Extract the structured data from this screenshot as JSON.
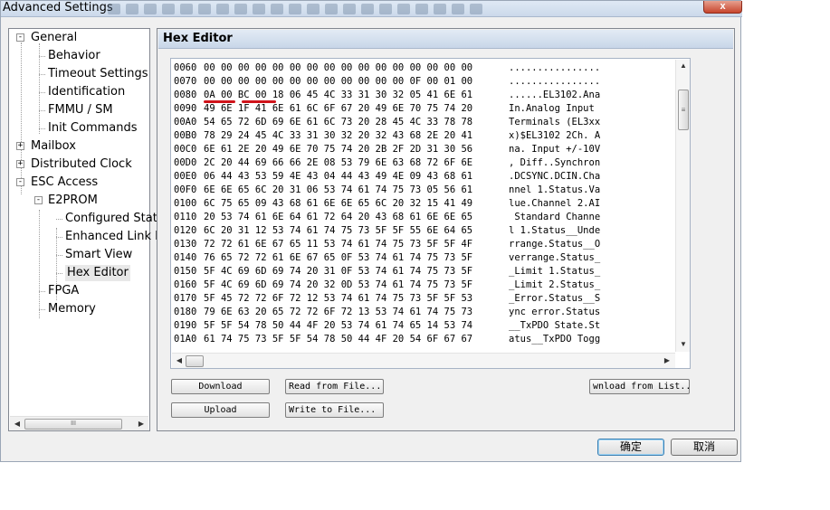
{
  "window": {
    "title": "Advanced Settings",
    "close_label": "x"
  },
  "tree": {
    "items": [
      {
        "label": "General",
        "level": 0,
        "expander": "-"
      },
      {
        "label": "Behavior",
        "level": 1
      },
      {
        "label": "Timeout Settings",
        "level": 1
      },
      {
        "label": "Identification",
        "level": 1
      },
      {
        "label": "FMMU / SM",
        "level": 1
      },
      {
        "label": "Init Commands",
        "level": 1
      },
      {
        "label": "Mailbox",
        "level": 0,
        "expander": "+"
      },
      {
        "label": "Distributed Clock",
        "level": 0,
        "expander": "+"
      },
      {
        "label": "ESC Access",
        "level": 0,
        "expander": "-"
      },
      {
        "label": "E2PROM",
        "level": 1,
        "expander": "-"
      },
      {
        "label": "Configured Stati",
        "level": 2
      },
      {
        "label": "Enhanced Link D",
        "level": 2
      },
      {
        "label": "Smart View",
        "level": 2
      },
      {
        "label": "Hex Editor",
        "level": 2,
        "selected": true
      },
      {
        "label": "FPGA",
        "level": 1
      },
      {
        "label": "Memory",
        "level": 1
      }
    ],
    "scroll_left": "◀",
    "scroll_right": "▶",
    "scroll_grip": "III"
  },
  "panel": {
    "title": "Hex Editor"
  },
  "hex": {
    "rows": [
      {
        "addr": "0060",
        "bytes": "00 00 00 00 00 00 00 00 00 00 00 00 00 00 00 00",
        "ascii": "................"
      },
      {
        "addr": "0070",
        "bytes": "00 00 00 00 00 00 00 00 00 00 00 00 0F 00 01 00",
        "ascii": "................"
      },
      {
        "addr": "0080",
        "bytes": "0A 00 BC 00 18 06 45 4C 33 31 30 32 05 41 6E 61",
        "ascii": "......EL3102.Ana"
      },
      {
        "addr": "0090",
        "bytes": "49 6E 1F 41 6E 61 6C 6F 67 20 49 6E 70 75 74 20",
        "ascii": "In.Analog Input "
      },
      {
        "addr": "00A0",
        "bytes": "54 65 72 6D 69 6E 61 6C 73 20 28 45 4C 33 78 78",
        "ascii": "Terminals (EL3xx"
      },
      {
        "addr": "00B0",
        "bytes": "78 29 24 45 4C 33 31 30 32 20 32 43 68 2E 20 41",
        "ascii": "x)$EL3102 2Ch. A"
      },
      {
        "addr": "00C0",
        "bytes": "6E 61 2E 20 49 6E 70 75 74 20 2B 2F 2D 31 30 56",
        "ascii": "na. Input +/-10V"
      },
      {
        "addr": "00D0",
        "bytes": "2C 20 44 69 66 66 2E 08 53 79 6E 63 68 72 6F 6E",
        "ascii": ", Diff..Synchron"
      },
      {
        "addr": "00E0",
        "bytes": "06 44 43 53 59 4E 43 04 44 43 49 4E 09 43 68 61",
        "ascii": ".DCSYNC.DCIN.Cha"
      },
      {
        "addr": "00F0",
        "bytes": "6E 6E 65 6C 20 31 06 53 74 61 74 75 73 05 56 61",
        "ascii": "nnel 1.Status.Va"
      },
      {
        "addr": "0100",
        "bytes": "6C 75 65 09 43 68 61 6E 6E 65 6C 20 32 15 41 49",
        "ascii": "lue.Channel 2.AI"
      },
      {
        "addr": "0110",
        "bytes": "20 53 74 61 6E 64 61 72 64 20 43 68 61 6E 6E 65",
        "ascii": " Standard Channe"
      },
      {
        "addr": "0120",
        "bytes": "6C 20 31 12 53 74 61 74 75 73 5F 5F 55 6E 64 65",
        "ascii": "l 1.Status__Unde"
      },
      {
        "addr": "0130",
        "bytes": "72 72 61 6E 67 65 11 53 74 61 74 75 73 5F 5F 4F",
        "ascii": "rrange.Status__O"
      },
      {
        "addr": "0140",
        "bytes": "76 65 72 72 61 6E 67 65 0F 53 74 61 74 75 73 5F",
        "ascii": "verrange.Status_"
      },
      {
        "addr": "0150",
        "bytes": "5F 4C 69 6D 69 74 20 31 0F 53 74 61 74 75 73 5F",
        "ascii": "_Limit 1.Status_"
      },
      {
        "addr": "0160",
        "bytes": "5F 4C 69 6D 69 74 20 32 0D 53 74 61 74 75 73 5F",
        "ascii": "_Limit 2.Status_"
      },
      {
        "addr": "0170",
        "bytes": "5F 45 72 72 6F 72 12 53 74 61 74 75 73 5F 5F 53",
        "ascii": "_Error.Status__S"
      },
      {
        "addr": "0180",
        "bytes": "79 6E 63 20 65 72 72 6F 72 13 53 74 61 74 75 73",
        "ascii": "ync error.Status"
      },
      {
        "addr": "0190",
        "bytes": "5F 5F 54 78 50 44 4F 20 53 74 61 74 65 14 53 74",
        "ascii": "__TxPDO State.St"
      },
      {
        "addr": "01A0",
        "bytes": "61 74 75 73 5F 5F 54 78 50 44 4F 20 54 6F 67 67",
        "ascii": "atus__TxPDO Togg"
      }
    ],
    "scroll_up": "▲",
    "scroll_down": "▼",
    "scroll_left": "◀",
    "scroll_right": "▶",
    "scroll_grip": "≡"
  },
  "buttons": {
    "download": "Download",
    "upload": "Upload",
    "read_from_file": "Read from File...",
    "write_to_file": "Write to File...",
    "download_from_list": "wnload from List..."
  },
  "footer": {
    "ok": "确定",
    "cancel": "取消"
  },
  "colors": {
    "highlight_underline": "#d0141b",
    "header_gradient_top": "#e3ebf5",
    "selected_bg": "#e8e8e8"
  }
}
